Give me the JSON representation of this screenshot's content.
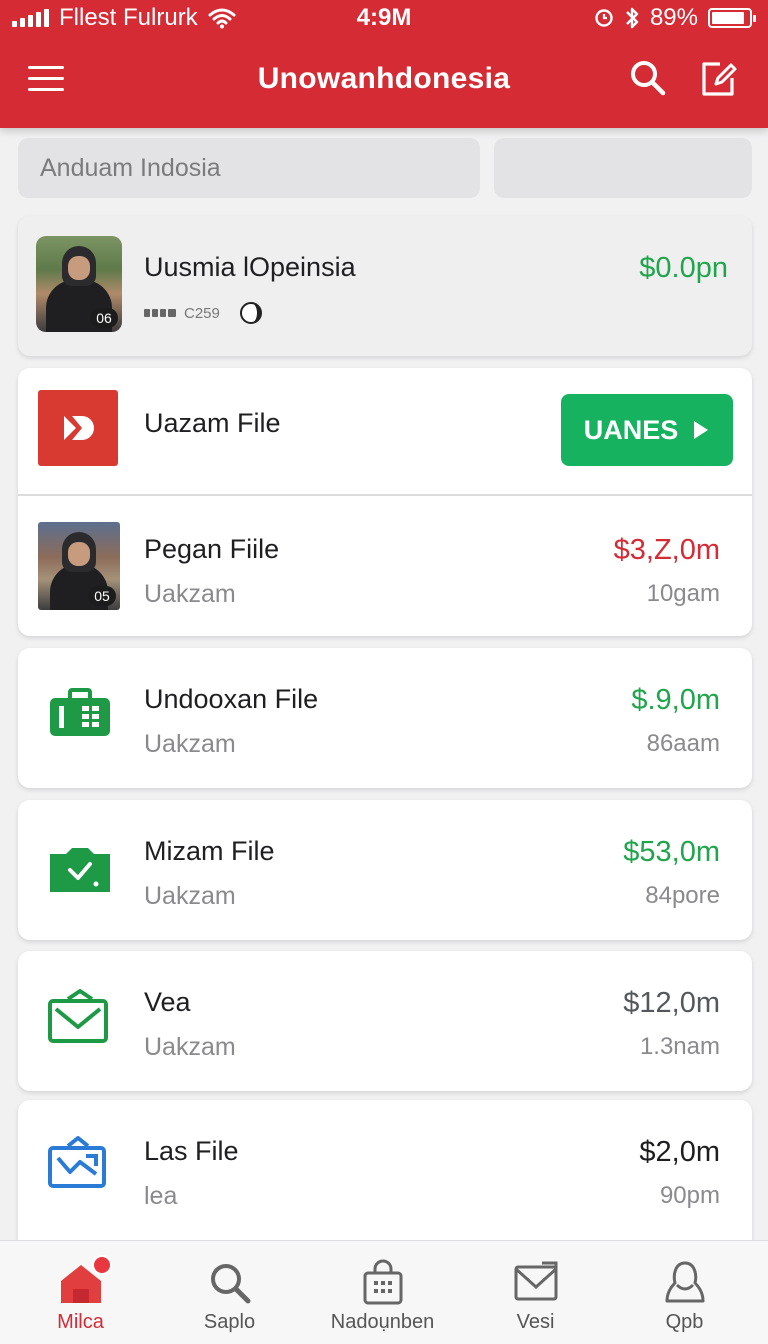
{
  "status_bar": {
    "carrier": "Fllest Fulrurk",
    "time": "4:9M",
    "battery": "89%",
    "battery_level": 0.89
  },
  "header": {
    "title": "Unowanhdonesia"
  },
  "search": {
    "value": "Anduam Indosia"
  },
  "account": {
    "name": "Uusmia lOpeinsia",
    "balance": "$0.0pn",
    "meta": "C259",
    "avatar_badge": "06"
  },
  "featured": {
    "title": "Uazam File",
    "button_label": "UANES"
  },
  "transactions": [
    {
      "title": "Pegan Fiile",
      "subtitle": "Uakzam",
      "amount": "$3,Z,0m",
      "time": "10gam",
      "avatar_badge": "05"
    },
    {
      "title": "Undooxan File",
      "subtitle": "Uakzam",
      "amount": "$.9,0m",
      "time": "86aam"
    },
    {
      "title": "Mizam File",
      "subtitle": "Uakzam",
      "amount": "$53,0m",
      "time": "84pore"
    },
    {
      "title": "Vea",
      "subtitle": "Uakzam",
      "amount": "$12,0m",
      "time": "1.3nam"
    },
    {
      "title": "Las File",
      "subtitle": "lea",
      "amount": "$2,0m",
      "time": "90pm"
    }
  ],
  "bottom_nav": [
    {
      "label": "Milca",
      "icon": "home-icon",
      "active": true
    },
    {
      "label": "Saplo",
      "icon": "search-icon",
      "active": false
    },
    {
      "label": "Nadoụnben",
      "icon": "shopping-bag-icon",
      "active": false
    },
    {
      "label": "Vesi",
      "icon": "mail-icon",
      "active": false
    },
    {
      "label": "Qpb",
      "icon": "profile-icon",
      "active": false
    }
  ],
  "colors": {
    "brand": "#d42b35",
    "positive": "#1fa54b",
    "negative": "#d42b35",
    "button": "#17b260"
  }
}
